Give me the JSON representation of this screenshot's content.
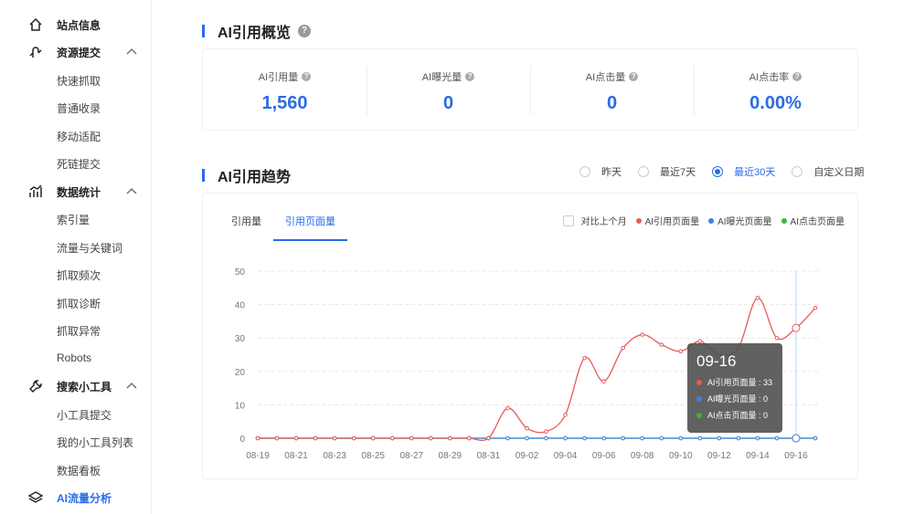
{
  "sidebar": {
    "groups": [
      {
        "label": "站点信息",
        "icon": "home-icon",
        "items": []
      },
      {
        "label": "资源提交",
        "icon": "resource-submit-icon",
        "items": [
          "快速抓取",
          "普通收录",
          "移动适配",
          "死链提交"
        ]
      },
      {
        "label": "数据统计",
        "icon": "bar-stats-icon",
        "items": [
          "索引量",
          "流量与关键词",
          "抓取频次",
          "抓取诊断",
          "抓取异常",
          "Robots"
        ]
      },
      {
        "label": "搜索小工具",
        "icon": "wrench-icon",
        "items": [
          "小工具提交",
          "我的小工具列表",
          "数据看板"
        ]
      },
      {
        "label": "AI流量分析",
        "icon": "layers-icon",
        "items": []
      }
    ],
    "active": "AI流量分析"
  },
  "overview": {
    "title": "AI引用概览",
    "metrics": [
      {
        "label": "AI引用量",
        "value": "1,560"
      },
      {
        "label": "AI曝光量",
        "value": "0"
      },
      {
        "label": "AI点击量",
        "value": "0"
      },
      {
        "label": "AI点击率",
        "value": "0.00%"
      }
    ]
  },
  "trend": {
    "title": "AI引用趋势",
    "ranges": [
      "昨天",
      "最近7天",
      "最近30天",
      "自定义日期"
    ],
    "selected_range": "最近30天",
    "tabs": [
      "引用量",
      "引用页面量"
    ],
    "active_tab": "引用页面量",
    "compare_label": "对比上个月",
    "tooltip": {
      "date": "09-16",
      "rows": [
        {
          "label": "AI引用页面量 : 33",
          "color": "#e85a5a"
        },
        {
          "label": "AI曝光页面量 : 0",
          "color": "#3f7ee8"
        },
        {
          "label": "AI点击页面量 : 0",
          "color": "#3cb53c"
        }
      ]
    }
  },
  "chart_data": {
    "type": "line",
    "x": [
      "08-19",
      "08-20",
      "08-21",
      "08-22",
      "08-23",
      "08-24",
      "08-25",
      "08-26",
      "08-27",
      "08-28",
      "08-29",
      "08-30",
      "08-31",
      "09-01",
      "09-02",
      "09-03",
      "09-04",
      "09-05",
      "09-06",
      "09-07",
      "09-08",
      "09-09",
      "09-10",
      "09-11",
      "09-12",
      "09-13",
      "09-14",
      "09-15",
      "09-16",
      "09-17"
    ],
    "xticks": [
      "08-19",
      "08-21",
      "08-23",
      "08-25",
      "08-27",
      "08-29",
      "08-31",
      "09-02",
      "09-04",
      "09-06",
      "09-08",
      "09-10",
      "09-12",
      "09-14",
      "09-16"
    ],
    "ylim": [
      0,
      50
    ],
    "yticks": [
      0,
      10,
      20,
      30,
      40,
      50
    ],
    "series": [
      {
        "name": "AI引用页面量",
        "color": "#e85a5a",
        "values": [
          0,
          0,
          0,
          0,
          0,
          0,
          0,
          0,
          0,
          0,
          0,
          0,
          0,
          9,
          3,
          2,
          7,
          24,
          17,
          27,
          31,
          28,
          26,
          29,
          25,
          27,
          42,
          30,
          33,
          39
        ]
      },
      {
        "name": "AI曝光页面量",
        "color": "#3f7ee8",
        "values": [
          0,
          0,
          0,
          0,
          0,
          0,
          0,
          0,
          0,
          0,
          0,
          0,
          0,
          0,
          0,
          0,
          0,
          0,
          0,
          0,
          0,
          0,
          0,
          0,
          0,
          0,
          0,
          0,
          0,
          0
        ]
      },
      {
        "name": "AI点击页面量",
        "color": "#3cb53c",
        "values": [
          0,
          0,
          0,
          0,
          0,
          0,
          0,
          0,
          0,
          0,
          0,
          0,
          0,
          0,
          0,
          0,
          0,
          0,
          0,
          0,
          0,
          0,
          0,
          0,
          0,
          0,
          0,
          0,
          0,
          0
        ]
      }
    ],
    "highlight_x": "09-16",
    "grid": true
  }
}
